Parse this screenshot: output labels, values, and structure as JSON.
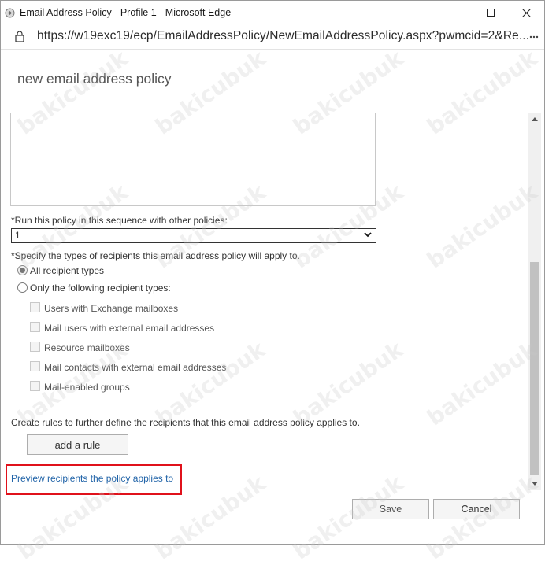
{
  "window": {
    "title": "Email Address Policy - Profile 1 - Microsoft Edge",
    "url": "https://w19exc19/ecp/EmailAddressPolicy/NewEmailAddressPolicy.aspx?pwmcid=2&Re..."
  },
  "dialog": {
    "title": "new email address policy",
    "sequence_label": "*Run this policy in this sequence with other policies:",
    "sequence_value": "1",
    "recipient_types_label": "*Specify the types of recipients this email address policy will apply to.",
    "radio_all": "All recipient types",
    "radio_only": "Only the following recipient types:",
    "checkboxes": [
      "Users with Exchange mailboxes",
      "Mail users with external email addresses",
      "Resource mailboxes",
      "Mail contacts with external email addresses",
      "Mail-enabled groups"
    ],
    "rules_text": "Create rules to further define the recipients that this email address policy applies to.",
    "add_rule_label": "add a rule",
    "preview_link": "Preview recipients the policy applies to",
    "save_label": "Save",
    "cancel_label": "Cancel"
  },
  "watermark": "bakicubuk",
  "colors": {
    "link": "#2063a8",
    "highlight_border": "#e0111b"
  }
}
